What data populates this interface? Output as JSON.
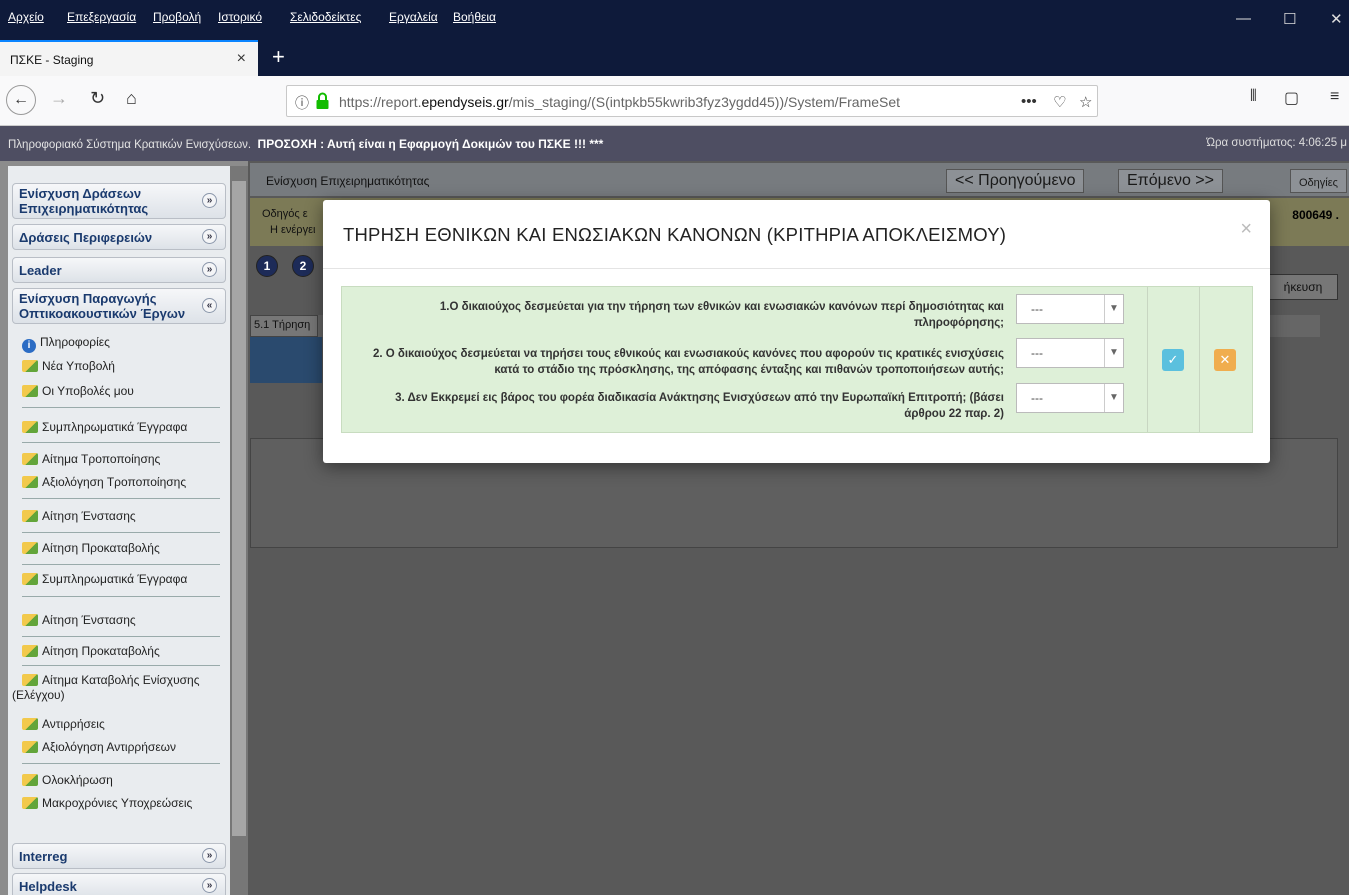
{
  "menu": [
    "Αρχείο",
    "Επεξεργασία",
    "Προβολή",
    "Ιστορικό",
    "Σελιδοδείκτες",
    "Εργαλεία",
    "Βοήθεια"
  ],
  "tab": {
    "title": "ΠΣΚΕ - Staging"
  },
  "url": {
    "prefix": "https://report.",
    "domain": "ependyseis.gr",
    "path": "/mis_staging/(S(intpkb55kwrib3fyz3ygdd45))/System/FrameSet"
  },
  "infobar": {
    "system": "Πληροφοριακό Σύστημα Κρατικών Ενισχύσεων.",
    "warning": "ΠΡΟΣΟΧΗ : Αυτή είναι η Εφαρμογή Δοκιμών του ΠΣΚΕ !!! ***",
    "time": "Ώρα συστήματος: 4:06:25 μ"
  },
  "sidebar": {
    "sections": [
      "Ενίσχυση Δράσεων Επιχειρηματικότητας",
      "Δράσεις Περιφερειών",
      "Leader",
      "Ενίσχυση Παραγωγής Οπτικοακουστικών Έργων",
      "Interreg",
      "Helpdesk"
    ],
    "items": [
      "Πληροφορίες",
      "Νέα Υποβολή",
      "Οι Υποβολές μου",
      "Συμπληρωματικά Έγγραφα",
      "Αίτημα Τροποποίησης",
      "Αξιολόγηση Τροποποίησης",
      "Αίτηση Ένστασης",
      "Αίτηση Προκαταβολής",
      "Συμπληρωματικά Έγγραφα",
      "Αίτηση Ένστασης",
      "Αίτηση Προκαταβολής",
      "Αίτημα Καταβολής Ενίσχυσης (Ελέγχου)",
      "Αντιρρήσεις",
      "Αξιολόγηση Αντιρρήσεων",
      "Ολοκλήρωση",
      "Μακροχρόνιες Υποχρεώσεις"
    ]
  },
  "main": {
    "title": "Ενίσχυση Επιχειρηματικότητας",
    "prev": "<< Προηγούμενο",
    "next": "Επόμενο >>",
    "help": "Οδηγίες",
    "guide": "Οδηγός ε",
    "active": "Η ενέργει",
    "code": "800649 .",
    "save": "ήκευση",
    "tab": "5.1 Τήρηση"
  },
  "modal": {
    "title": "ΤΗΡΗΣΗ ΕΘΝΙΚΩΝ ΚΑΙ ΕΝΩΣΙΑΚΩΝ ΚΑΝΟΝΩΝ (ΚΡΙΤΗΡΙΑ ΑΠΟΚΛΕΙΣΜΟΥ)",
    "close": "×",
    "questions": [
      {
        "text": "1.Ο δικαιούχος δεσμεύεται για την τήρηση των εθνικών και ενωσιακών κανόνων περί δημοσιότητας και πληροφόρησης;",
        "value": "---"
      },
      {
        "text": "2. Ο δικαιούχος δεσμεύεται να τηρήσει τους εθνικούς και ενωσιακούς κανόνες που αφορούν τις κρατικές ενισχύσεις κατά το στάδιο της πρόσκλησης, της απόφασης ένταξης και πιθανών τροποποιήσεων αυτής;",
        "value": "---"
      },
      {
        "text": "3. Δεν Εκκρεμεί εις βάρος του φορέα διαδικασία Ανάκτησης Ενισχύσεων από την Ευρωπαϊκή Επιτροπή; (βάσει άρθρου 22 παρ. 2)",
        "value": "---"
      }
    ],
    "colors": {
      "save": "#5bc0de",
      "cancel": "#f0ad4e"
    }
  }
}
